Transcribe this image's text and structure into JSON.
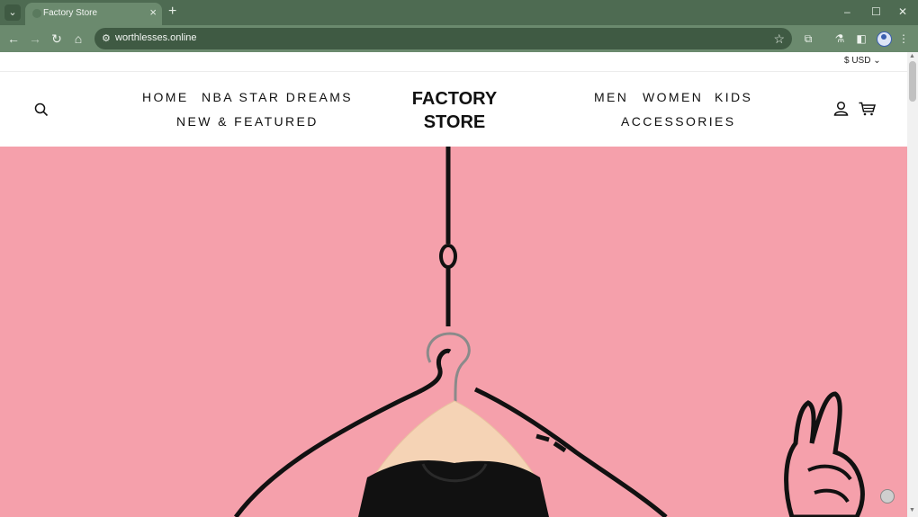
{
  "browser": {
    "tab_title": "Factory Store",
    "url": "worthlesses.online",
    "icons": {
      "tab_menu": "chevron-down-icon",
      "close": "close-icon",
      "new_tab": "plus-icon",
      "back": "arrow-left-icon",
      "forward": "arrow-right-icon",
      "reload": "reload-icon",
      "home": "home-icon",
      "site_info": "tune-icon",
      "bookmark": "star-icon",
      "extensions": "puzzle-icon",
      "labs": "flask-icon",
      "side_panel": "side-panel-icon",
      "profile": "profile-icon",
      "menu": "kebab-menu-icon"
    },
    "colors": {
      "frame": "#4e6b52",
      "toolbar": "#6b8a6e",
      "omnibox": "#3f5a43"
    }
  },
  "store": {
    "currency": "$ USD",
    "logo": {
      "line1": "FACTORY",
      "line2": "STORE"
    },
    "nav_left": {
      "row1": [
        "HOME",
        "NBA STAR DREAMS"
      ],
      "row2": [
        "NEW & FEATURED"
      ]
    },
    "nav_right": {
      "row1": [
        "MEN",
        "WOMEN",
        "KIDS"
      ],
      "row2": [
        "ACCESSORIES"
      ]
    },
    "icons": {
      "search": "search-icon",
      "account": "account-icon",
      "cart": "cart-icon"
    },
    "colors": {
      "hero_background": "#f5a0ab",
      "hero_line": "#111111",
      "hanger": "#f5d3b5",
      "shirt": "#111111"
    }
  }
}
